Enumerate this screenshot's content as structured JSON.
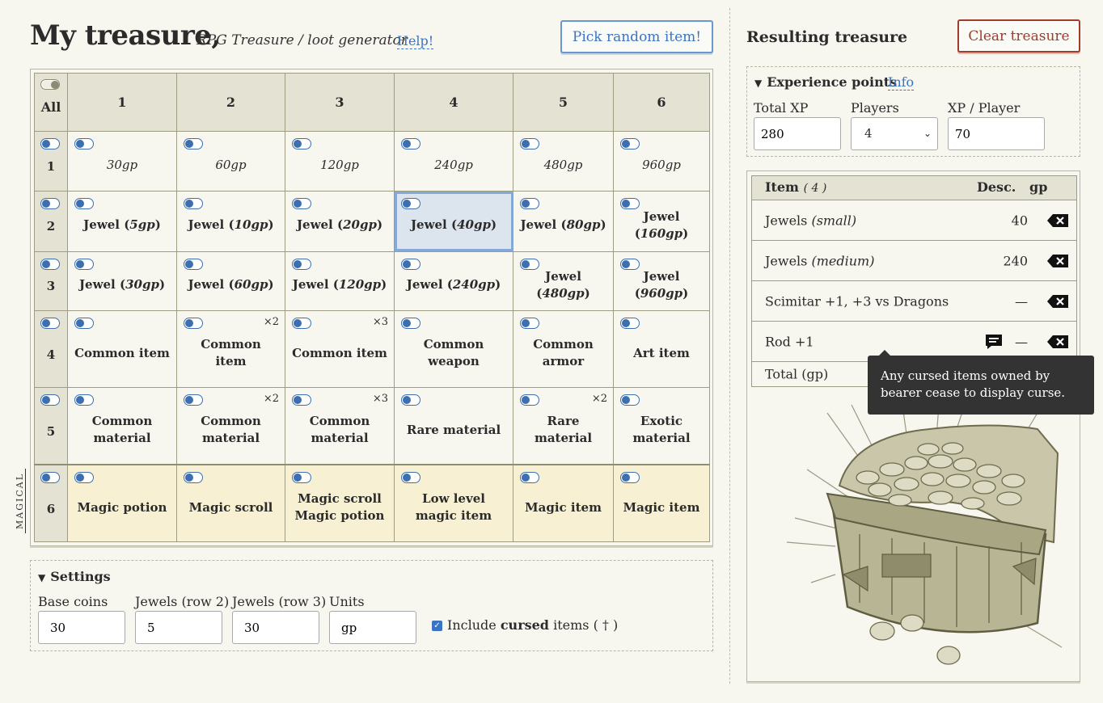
{
  "header": {
    "title": "My treasure",
    "comma": ",",
    "subtitle": "RPG Treasure / loot generator",
    "help": "Help!",
    "pick_button": "Pick random item!",
    "result_title": "Resulting treasure",
    "clear_button": "Clear treasure"
  },
  "grid": {
    "all_label": "All",
    "columns": [
      "1",
      "2",
      "3",
      "4",
      "5",
      "6"
    ],
    "rows": [
      {
        "label": "1",
        "cells": [
          {
            "text": "30gp",
            "type": "coin"
          },
          {
            "text": "60gp",
            "type": "coin"
          },
          {
            "text": "120gp",
            "type": "coin"
          },
          {
            "text": "240gp",
            "type": "coin"
          },
          {
            "text": "480gp",
            "type": "coin"
          },
          {
            "text": "960gp",
            "type": "coin"
          }
        ]
      },
      {
        "label": "2",
        "cells": [
          {
            "text": "Jewel",
            "paren": "5gp"
          },
          {
            "text": "Jewel",
            "paren": "10gp"
          },
          {
            "text": "Jewel",
            "paren": "20gp"
          },
          {
            "text": "Jewel",
            "paren": "40gp",
            "selected": true
          },
          {
            "text": "Jewel",
            "paren": "80gp"
          },
          {
            "text": "Jewel",
            "paren": "160gp"
          }
        ]
      },
      {
        "label": "3",
        "cells": [
          {
            "text": "Jewel",
            "paren": "30gp"
          },
          {
            "text": "Jewel",
            "paren": "60gp"
          },
          {
            "text": "Jewel",
            "paren": "120gp"
          },
          {
            "text": "Jewel",
            "paren": "240gp"
          },
          {
            "text": "Jewel",
            "paren": "480gp"
          },
          {
            "text": "Jewel",
            "paren": "960gp"
          }
        ]
      },
      {
        "label": "4",
        "cells": [
          {
            "text": "Common item"
          },
          {
            "text": "Common item",
            "mult": "×2"
          },
          {
            "text": "Common item",
            "mult": "×3"
          },
          {
            "text": "Common weapon"
          },
          {
            "text": "Common armor"
          },
          {
            "text": "Art item"
          }
        ]
      },
      {
        "label": "5",
        "cells": [
          {
            "text": "Common material"
          },
          {
            "text": "Common material",
            "mult": "×2"
          },
          {
            "text": "Common material",
            "mult": "×3"
          },
          {
            "text": "Rare material"
          },
          {
            "text": "Rare material",
            "mult": "×2"
          },
          {
            "text": "Exotic material"
          }
        ]
      },
      {
        "label": "6",
        "magic": true,
        "cells": [
          {
            "text": "Magic potion"
          },
          {
            "text": "Magic scroll"
          },
          {
            "text": "Magic scroll",
            "line2": "Magic potion"
          },
          {
            "text": "Low level magic item"
          },
          {
            "text": "Magic item"
          },
          {
            "text": "Magic item"
          }
        ]
      }
    ],
    "magical_label": "MAGICAL"
  },
  "settings": {
    "heading": "Settings",
    "base_coins_label": "Base coins",
    "base_coins_value": "30",
    "jewels2_label": "Jewels (row 2)",
    "jewels2_value": "5",
    "jewels3_label": "Jewels (row 3)",
    "jewels3_value": "30",
    "units_label": "Units",
    "units_value": "gp",
    "cursed_prefix": "Include ",
    "cursed_bold": "cursed",
    "cursed_suffix": " items ( † )",
    "cursed_checked": true
  },
  "xp": {
    "heading": "Experience points",
    "info": "Info",
    "total_label": "Total XP",
    "total_value": "280",
    "players_label": "Players",
    "players_value": "4",
    "per_player_label": "XP / Player",
    "per_player_value": "70"
  },
  "items": {
    "header_item": "Item",
    "header_count": "( 4 )",
    "header_desc": "Desc.",
    "header_gp": "gp",
    "rows": [
      {
        "name": "Jewels",
        "paren": "(small)",
        "gp": "40"
      },
      {
        "name": "Jewels",
        "paren": "(medium)",
        "gp": "240"
      },
      {
        "name": "Scimitar +1, +3 vs Dragons",
        "paren": "",
        "gp": "—"
      },
      {
        "name": "Rod +1",
        "paren": "",
        "gp": "—",
        "has_desc": true
      }
    ],
    "total_label": "Total (gp)"
  },
  "tooltip": "Any cursed items owned by bearer cease to display curse.",
  "colors": {
    "accent_blue": "#3a74c4",
    "clear_red": "#a23b2a",
    "magic_row": "#f7f0d2",
    "header_bg": "#e3e2d3"
  }
}
